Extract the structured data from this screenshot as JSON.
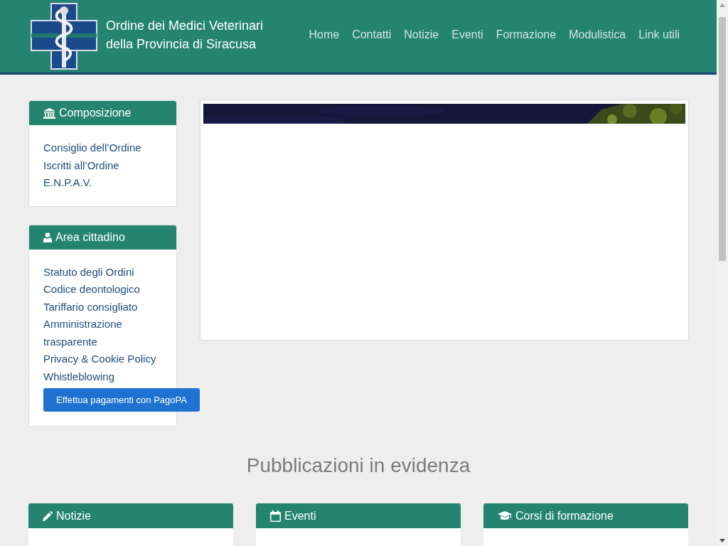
{
  "header": {
    "title_lines": [
      "Ordine dei Medici Veterinari",
      "della Provincia di Siracusa"
    ],
    "nav": [
      {
        "label": "Home"
      },
      {
        "label": "Contatti"
      },
      {
        "label": "Notizie"
      },
      {
        "label": "Eventi"
      },
      {
        "label": "Formazione"
      },
      {
        "label": "Modulistica"
      },
      {
        "label": "Link utili"
      }
    ]
  },
  "sidebar": [
    {
      "title": "Composizione",
      "links": [
        "Consiglio dell’Ordine",
        "Iscritti all’Ordine",
        "E.N.P.A.V."
      ]
    },
    {
      "title": "Area cittadino",
      "links": [
        "Statuto degli Ordini",
        "Codice deontologico",
        "Tariffario consigliato",
        "Amministrazione trasparente",
        "Privacy & Cookie Policy",
        "Whistleblowing"
      ],
      "button": "Effettua pagamenti con PagoPA"
    }
  ],
  "section_title": "Pubblicazioni in evidenza",
  "publications": [
    {
      "title": "Notizie"
    },
    {
      "title": "Eventi"
    },
    {
      "title": "Corsi di formazione"
    }
  ]
}
